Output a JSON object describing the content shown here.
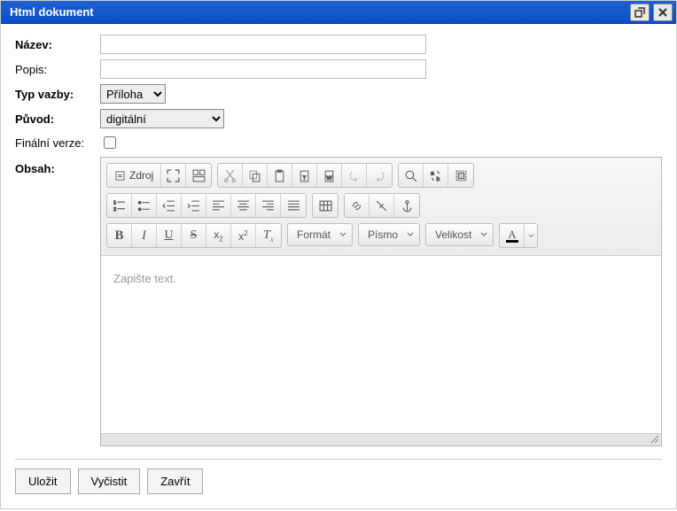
{
  "window": {
    "title": "Html dokument"
  },
  "labels": {
    "name": "Název:",
    "description": "Popis:",
    "bindingType": "Typ vazby:",
    "origin": "Původ:",
    "finalVersion": "Finální verze:",
    "content": "Obsah:"
  },
  "values": {
    "name": "",
    "description": "",
    "bindingType": "Příloha",
    "origin": "digitální",
    "finalVersion": false
  },
  "editor": {
    "sourceLabel": "Zdroj",
    "placeholder": "Zapište text.",
    "combos": {
      "format": "Formát",
      "font": "Písmo",
      "size": "Velikost"
    }
  },
  "footer": {
    "save": "Uložit",
    "clear": "Vyčistit",
    "close": "Zavřít"
  }
}
